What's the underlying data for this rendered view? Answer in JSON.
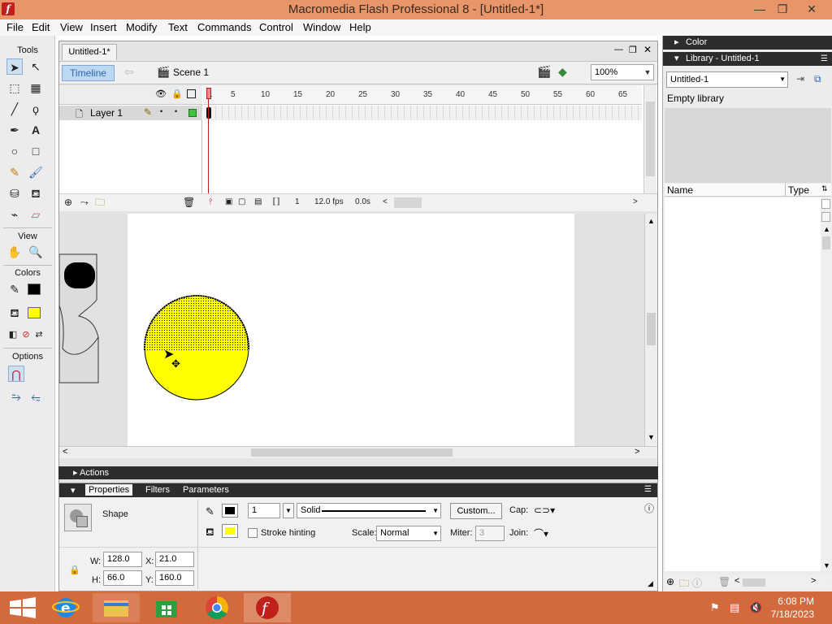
{
  "window": {
    "title": "Macromedia Flash Professional 8 - [Untitled-1*]",
    "app_icon": "f",
    "min_glyph": "—",
    "restore_glyph": "❐",
    "close_glyph": "✕"
  },
  "menu": [
    "File",
    "Edit",
    "View",
    "Insert",
    "Modify",
    "Text",
    "Commands",
    "Control",
    "Window",
    "Help"
  ],
  "tools": {
    "title": "Tools",
    "view_title": "View",
    "colors_title": "Colors",
    "options_title": "Options"
  },
  "document": {
    "tab_label": "Untitled-1*",
    "timeline_button": "Timeline",
    "scene_label": "Scene 1",
    "zoom": "100%"
  },
  "timeline": {
    "layer_name": "Layer 1",
    "ruler": [
      "1",
      "5",
      "10",
      "15",
      "20",
      "25",
      "30",
      "35",
      "40",
      "45",
      "50",
      "55",
      "60",
      "65"
    ],
    "current_frame": "1",
    "fps": "12.0 fps",
    "elapsed": "0.0s"
  },
  "panels": {
    "actions_label": "Actions",
    "tabs": [
      "Properties",
      "Filters",
      "Parameters"
    ]
  },
  "properties": {
    "selection_type": "Shape",
    "stroke_height": "1",
    "stroke_style": "Solid",
    "custom_button": "Custom...",
    "cap_label": "Cap:",
    "stroke_hinting_label": "Stroke hinting",
    "scale_label": "Scale:",
    "scale_value": "Normal",
    "miter_label": "Miter:",
    "miter_value": "3",
    "join_label": "Join:",
    "w_label": "W:",
    "w_value": "128.0",
    "x_label": "X:",
    "x_value": "21.0",
    "h_label": "H:",
    "h_value": "66.0",
    "y_label": "Y:",
    "y_value": "160.0"
  },
  "color_panel": {
    "title": "Color"
  },
  "library": {
    "title": "Library - Untitled-1",
    "document_select": "Untitled-1",
    "empty_text": "Empty library",
    "col_name": "Name",
    "col_type": "Type"
  },
  "taskbar": {
    "time": "6:08 PM",
    "date": "7/18/2023"
  },
  "colors": {
    "stroke": "#000000",
    "fill": "#ffff00",
    "titlebar": "#e8956a",
    "taskbar": "#d36a3d"
  }
}
